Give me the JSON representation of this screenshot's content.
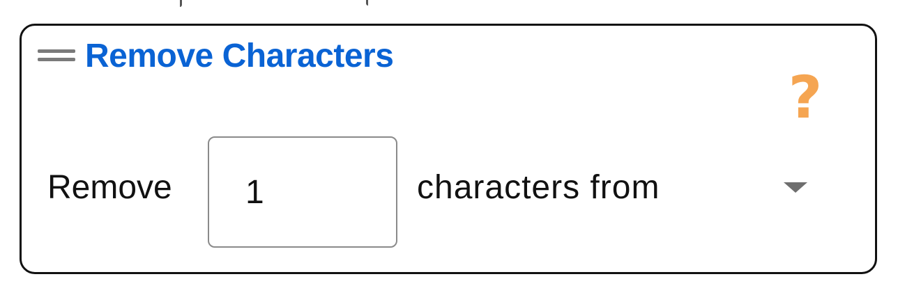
{
  "block": {
    "title": "Remove Characters",
    "help_symbol": "?",
    "prefix_label": "Remove",
    "count_value": "1",
    "suffix_label": "characters from",
    "from_select_value": ""
  },
  "colors": {
    "title": "#0a63d4",
    "help_icon": "#f5a552",
    "border": "#111111",
    "input_border": "#8a8a8a",
    "handle": "#7a7a7a"
  },
  "icons": {
    "handle": "drag-handle-icon",
    "help": "help-icon",
    "dropdown": "caret-down-icon"
  }
}
